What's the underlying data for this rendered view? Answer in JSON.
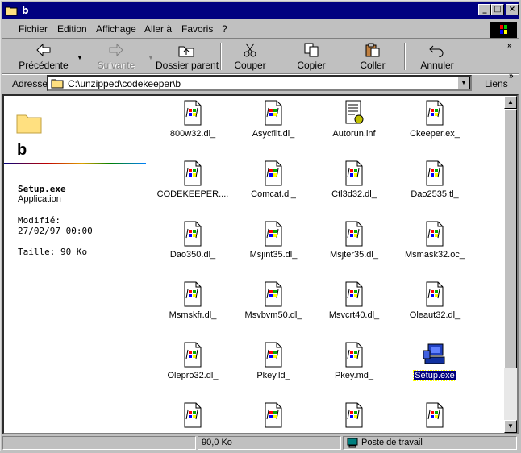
{
  "window": {
    "title": "b"
  },
  "menu": [
    "Fichier",
    "Edition",
    "Affichage",
    "Aller à",
    "Favoris",
    "?"
  ],
  "toolbar": {
    "back": "Précédente",
    "forward": "Suivante",
    "up": "Dossier parent",
    "cut": "Couper",
    "copy": "Copier",
    "paste": "Coller",
    "undo": "Annuler"
  },
  "address": {
    "label": "Adresse",
    "value": "C:\\unzipped\\codekeeper\\b",
    "links": "Liens"
  },
  "sidebar": {
    "folder_name": "b",
    "file_name": "Setup.exe",
    "file_type": "Application",
    "modified_label": "Modifié:",
    "modified_value": "27/02/97 00:00",
    "size": "Taille: 90 Ko"
  },
  "files": [
    {
      "name": "800w32.dl_",
      "type": "generic"
    },
    {
      "name": "Asycfilt.dl_",
      "type": "generic"
    },
    {
      "name": "Autorun.inf",
      "type": "inf"
    },
    {
      "name": "Ckeeper.ex_",
      "type": "generic"
    },
    {
      "name": "CODEKEEPER....",
      "type": "generic"
    },
    {
      "name": "Comcat.dl_",
      "type": "generic"
    },
    {
      "name": "Ctl3d32.dl_",
      "type": "generic"
    },
    {
      "name": "Dao2535.tl_",
      "type": "generic"
    },
    {
      "name": "Dao350.dl_",
      "type": "generic"
    },
    {
      "name": "Msjint35.dl_",
      "type": "generic"
    },
    {
      "name": "Msjter35.dl_",
      "type": "generic"
    },
    {
      "name": "Msmask32.oc_",
      "type": "generic"
    },
    {
      "name": "Msmskfr.dl_",
      "type": "generic"
    },
    {
      "name": "Msvbvm50.dl_",
      "type": "generic"
    },
    {
      "name": "Msvcrt40.dl_",
      "type": "generic"
    },
    {
      "name": "Oleaut32.dl_",
      "type": "generic"
    },
    {
      "name": "Olepro32.dl_",
      "type": "generic"
    },
    {
      "name": "Pkey.ld_",
      "type": "generic"
    },
    {
      "name": "Pkey.md_",
      "type": "generic"
    },
    {
      "name": "Setup.exe",
      "type": "setup",
      "selected": true
    },
    {
      "name": "",
      "type": "generic"
    },
    {
      "name": "",
      "type": "generic"
    },
    {
      "name": "",
      "type": "generic"
    },
    {
      "name": "",
      "type": "generic"
    }
  ],
  "status": {
    "size": "90,0 Ko",
    "zone": "Poste de travail"
  }
}
